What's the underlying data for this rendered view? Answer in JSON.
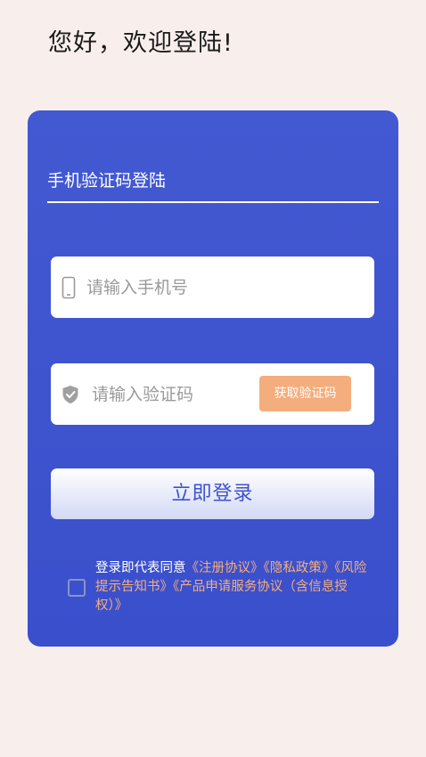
{
  "greeting": "您好，欢迎登陆!",
  "tab": {
    "title": "手机验证码登陆"
  },
  "phone_field": {
    "placeholder": "请输入手机号",
    "value": ""
  },
  "code_field": {
    "placeholder": "请输入验证码",
    "value": "",
    "get_code_label": "获取验证码"
  },
  "login_button": {
    "label": "立即登录"
  },
  "agreement": {
    "checked": false,
    "prefix": "登录即代表同意",
    "links": [
      "《注册协议》",
      "《隐私政策》",
      "《风险提示告知书》",
      "《产品申请服务协议（含信息授权）》"
    ]
  },
  "colors": {
    "background": "#f8efed",
    "card": "#4359d2",
    "accent_orange": "#f4ad7d",
    "login_text": "#3d52cf"
  },
  "icons": {
    "phone_field": "phone-icon",
    "code_field": "shield-check-icon"
  }
}
